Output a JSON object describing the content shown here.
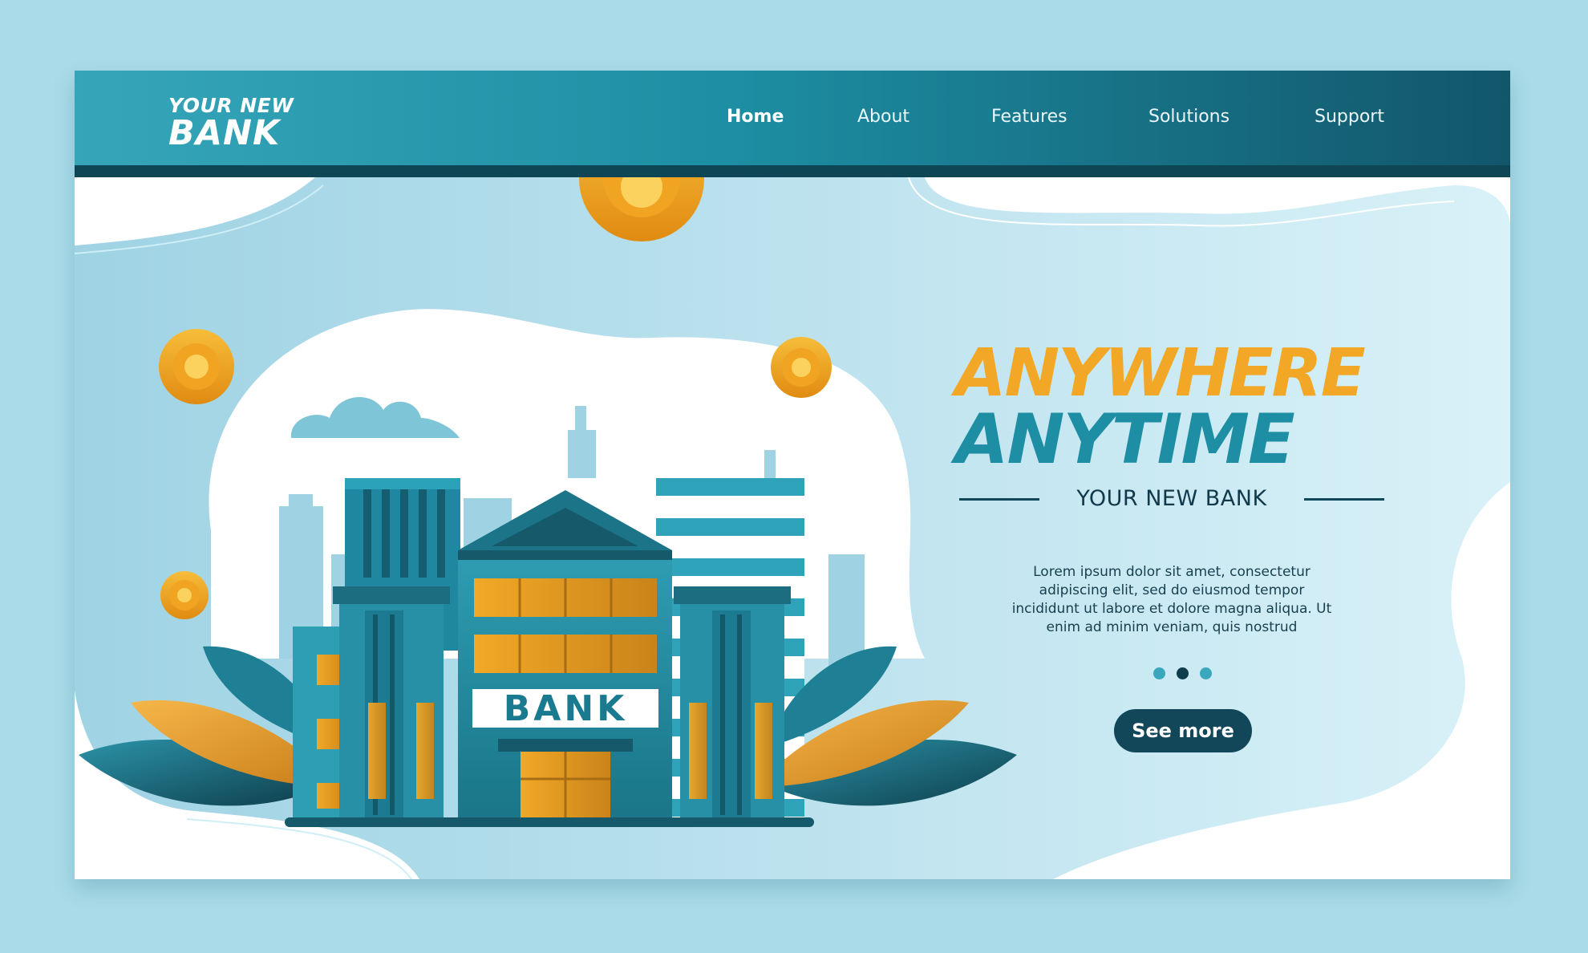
{
  "brand": {
    "line1": "YOUR NEW",
    "line2": "BANK"
  },
  "nav": {
    "items": [
      {
        "label": "Home",
        "active": true
      },
      {
        "label": "About",
        "active": false
      },
      {
        "label": "Features",
        "active": false
      },
      {
        "label": "Solutions",
        "active": false
      },
      {
        "label": "Support",
        "active": false
      }
    ]
  },
  "hero": {
    "headline_line1": "ANYWHERE",
    "headline_line2": "ANYTIME",
    "subtitle": "YOUR NEW BANK",
    "body": "Lorem ipsum dolor sit amet, consectetur adipiscing elit, sed do eiusmod tempor incididunt ut labore et dolore magna aliqua. Ut enim ad minim veniam, quis nostrud",
    "cta_label": "See more",
    "carousel": {
      "count": 3,
      "active_index": 1
    }
  },
  "illustration": {
    "building_sign": "BANK",
    "icons": [
      "coin-icon",
      "cloud-icon",
      "leaf-icon",
      "bank-building-icon"
    ]
  },
  "colors": {
    "page_bg": "#a9dbe8",
    "nav_start": "#36a5b9",
    "nav_end": "#12566a",
    "accent_gold": "#f2a826",
    "accent_teal": "#1d8ea3",
    "dark": "#12475a"
  }
}
